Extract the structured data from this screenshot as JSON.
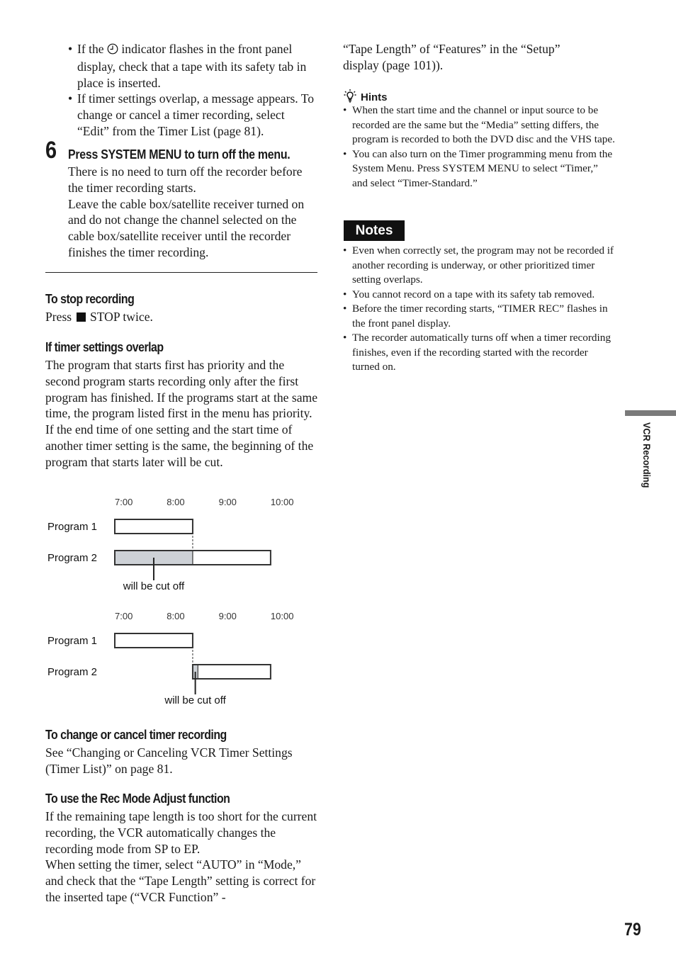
{
  "left_column": {
    "top_bullets": [
      {
        "pre": "If the ",
        "icon": "clock-icon",
        "post": " indicator flashes in the front panel display, check that a tape with its safety tab in place is inserted."
      },
      {
        "text": "If timer settings overlap, a message appears. To change or cancel a timer recording, select “Edit” from the Timer List (page 81)."
      }
    ],
    "step": {
      "number": "6",
      "title": "Press SYSTEM MENU to turn off the menu.",
      "paragraphs": [
        "There is no need to turn off the recorder before the timer recording starts.",
        "Leave the cable box/satellite receiver turned on and do not change the channel selected on the cable box/satellite receiver until the recorder finishes the timer recording."
      ]
    },
    "stop_recording": {
      "heading": "To stop recording",
      "pre": "Press",
      "icon": "stop-icon",
      "post": "STOP twice."
    },
    "overlap": {
      "heading": "If timer settings overlap",
      "text": "The program that starts first has priority and the second program starts recording only after the first program has finished. If the programs start at the same time, the program listed first in the menu has priority. If the end time of one setting and the start time of another timer setting is the same, the beginning of the program that starts later will be cut."
    },
    "change_cancel": {
      "heading": "To change or cancel timer recording",
      "text": "See “Changing or Canceling VCR Timer Settings (Timer List)” on page 81."
    },
    "rec_mode": {
      "heading": "To use the Rec Mode Adjust function",
      "paragraphs": [
        "If the remaining tape length is too short for the current recording, the VCR automatically changes the recording mode from SP to EP.",
        "When setting the timer, select “AUTO” in “Mode,” and check that the “Tape Length” setting is correct for the inserted tape (“VCR Function” -"
      ]
    }
  },
  "chart_data": [
    {
      "type": "timeline",
      "title": "",
      "x_ticks": [
        "7:00",
        "8:00",
        "9:00",
        "10:00"
      ],
      "x_range_hours": [
        7.0,
        10.3
      ],
      "rows": [
        {
          "label": "Program 1",
          "start": 7.0,
          "end": 8.5,
          "cut_end": null
        },
        {
          "label": "Program 2",
          "start": 7.0,
          "end": 10.0,
          "cut_end": 8.5
        }
      ],
      "annotation": "will be cut off"
    },
    {
      "type": "timeline",
      "title": "",
      "x_ticks": [
        "7:00",
        "8:00",
        "9:00",
        "10:00"
      ],
      "x_range_hours": [
        7.0,
        10.3
      ],
      "rows": [
        {
          "label": "Program 1",
          "start": 7.0,
          "end": 8.5,
          "cut_end": null
        },
        {
          "label": "Program 2",
          "start": 8.5,
          "end": 10.0,
          "cut_end": 8.6
        }
      ],
      "annotation": "will be cut off"
    }
  ],
  "right_column": {
    "continuation": "“Tape Length” of “Features” in the “Setup” display (page 101)).",
    "hints": {
      "icon": "lightbulb-icon",
      "title": "Hints",
      "items": [
        "When the start time and the channel or input source to be recorded are the same but the “Media” setting differs, the program is recorded to both the DVD disc and the VHS tape.",
        "You can also turn on the Timer programming menu from the System Menu. Press SYSTEM MENU to select “Timer,” and select “Timer-Standard.”"
      ]
    },
    "notes": {
      "title": "Notes",
      "items": [
        "Even when correctly set, the program may not be recorded if another recording is underway, or other prioritized timer setting overlaps.",
        "You cannot record on a tape with its safety tab removed.",
        "Before the timer recording starts, “TIMER REC” flashes in the front panel display.",
        "The recorder automatically turns off when a timer recording finishes, even if the recording started with the recorder turned on."
      ]
    }
  },
  "side_tab": {
    "label": "VCR Recording",
    "color": "#7a7a7a"
  },
  "page_number": "79"
}
